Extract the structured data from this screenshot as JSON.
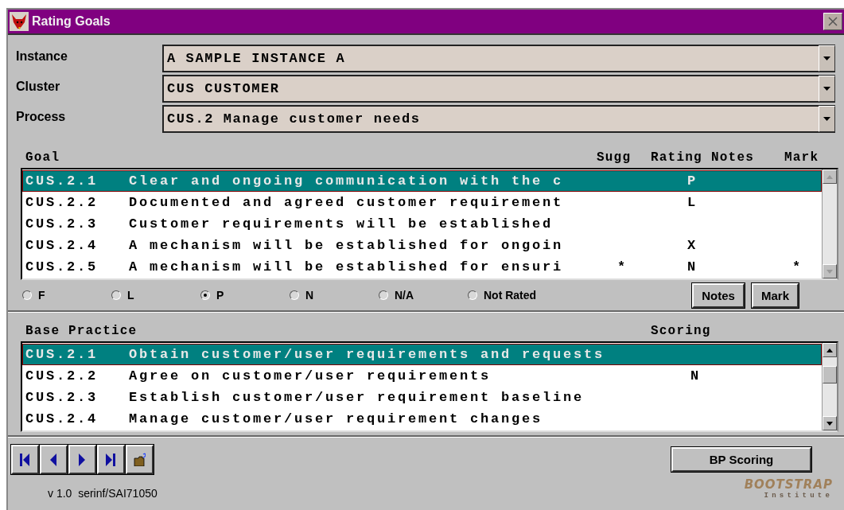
{
  "window": {
    "title": "Rating Goals"
  },
  "selectors": [
    {
      "label": "Instance",
      "value": "A SAMPLE INSTANCE A"
    },
    {
      "label": "Cluster",
      "value": "CUS CUSTOMER"
    },
    {
      "label": "Process",
      "value": "CUS.2 Manage customer needs"
    }
  ],
  "goals": {
    "columns": [
      "Goal",
      "Sugg",
      "Rating",
      "Notes",
      "Mark"
    ],
    "rows": [
      {
        "code": "CUS.2.1",
        "text": "Clear and ongoing communication with the c",
        "rating": "P",
        "selected": true
      },
      {
        "code": "CUS.2.2",
        "text": "Documented and agreed customer requirement",
        "rating": "L",
        "selected": false
      },
      {
        "code": "CUS.2.3",
        "text": "Customer requirements will be established",
        "selected": false
      },
      {
        "code": "CUS.2.4",
        "text": "A mechanism will be established for ongoin",
        "rating": "X",
        "selected": false
      },
      {
        "code": "CUS.2.5",
        "text": "A mechanism will be established for ensuri",
        "sugg": "*",
        "rating": "N",
        "mark": "*",
        "selected": false
      }
    ]
  },
  "rating_options": [
    {
      "label": "F",
      "selected": false
    },
    {
      "label": "L",
      "selected": false
    },
    {
      "label": "P",
      "selected": true
    },
    {
      "label": "N",
      "selected": false
    },
    {
      "label": "N/A",
      "selected": false
    },
    {
      "label": "Not Rated",
      "selected": false
    }
  ],
  "goal_buttons": [
    "Notes",
    "Mark"
  ],
  "base_practices": {
    "columns": [
      "Base Practice",
      "Scoring"
    ],
    "rows": [
      {
        "code": "CUS.2.1",
        "text": "Obtain customer/user requirements and requests",
        "selected": true
      },
      {
        "code": "CUS.2.2",
        "text": "Agree on customer/user requirements",
        "scoring": "N",
        "selected": false
      },
      {
        "code": "CUS.2.3",
        "text": "Establish customer/user requirement baseline",
        "selected": false
      },
      {
        "code": "CUS.2.4",
        "text": "Manage customer/user requirement changes",
        "selected": false
      }
    ]
  },
  "bp_scoring_button": "BP Scoring",
  "version": "v 1.0  serinf/SAI71050",
  "logo": {
    "name": "BOOTSTRAP",
    "subtitle": "Institute"
  }
}
